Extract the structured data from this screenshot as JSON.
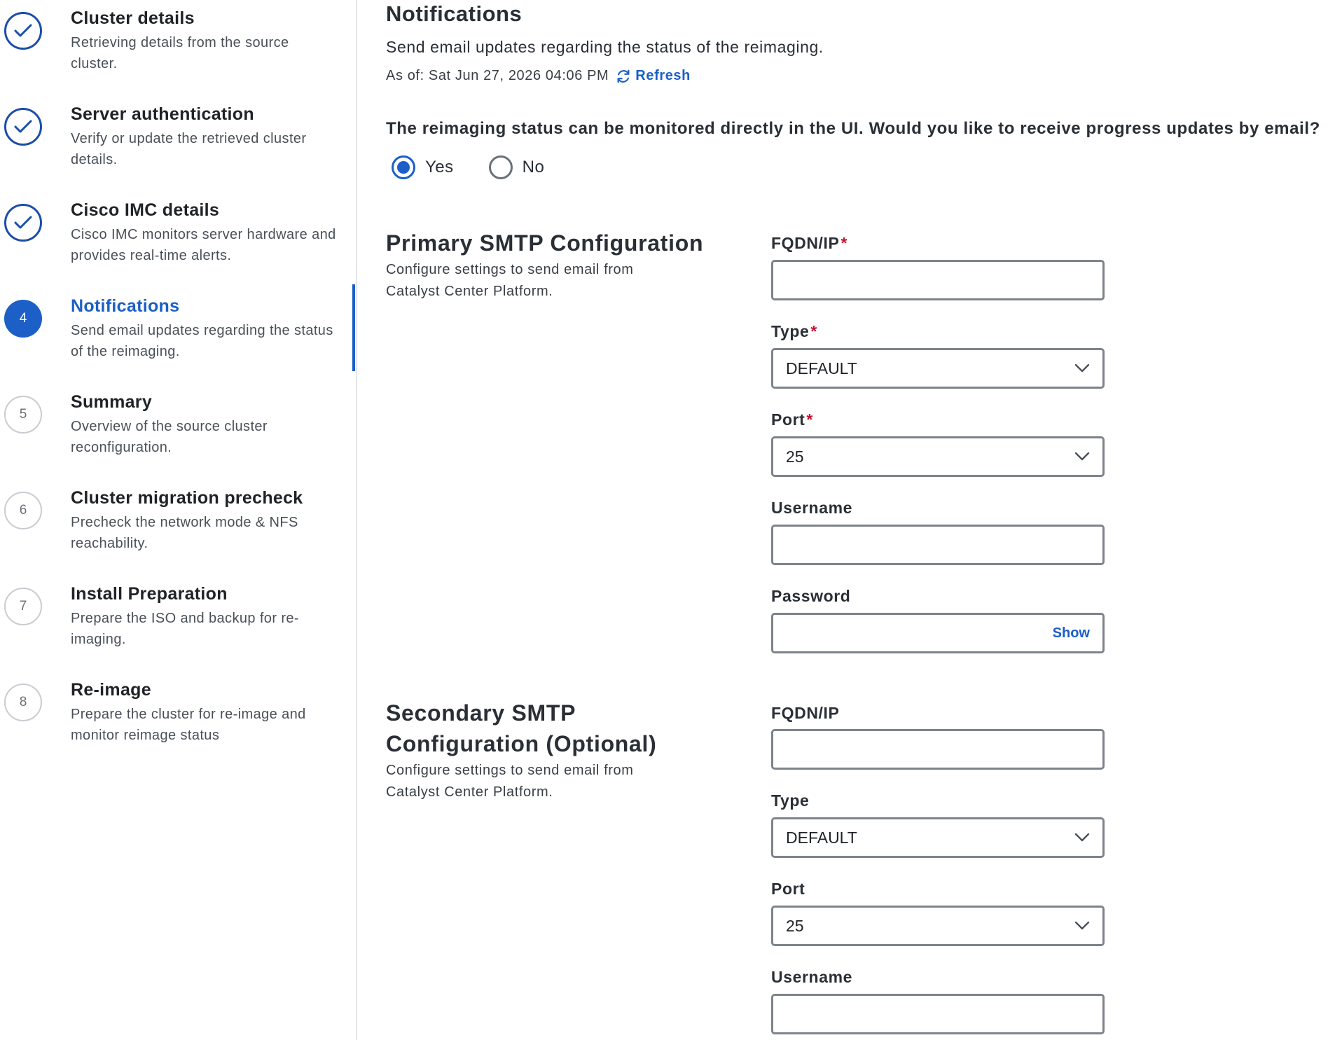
{
  "sidebar": {
    "steps": [
      {
        "number": "",
        "status": "done",
        "title": "Cluster details",
        "desc": "Retrieving details from the source cluster."
      },
      {
        "number": "",
        "status": "done",
        "title": "Server authentication",
        "desc": "Verify or update the retrieved cluster details."
      },
      {
        "number": "",
        "status": "done",
        "title": "Cisco IMC details",
        "desc": "Cisco IMC monitors server hardware and provides real-time alerts."
      },
      {
        "number": "4",
        "status": "current",
        "title": "Notifications",
        "desc": "Send email updates regarding the status of the reimaging."
      },
      {
        "number": "5",
        "status": "todo",
        "title": "Summary",
        "desc": "Overview of the source cluster reconfiguration."
      },
      {
        "number": "6",
        "status": "todo",
        "title": "Cluster migration precheck",
        "desc": "Precheck the network mode & NFS reachability."
      },
      {
        "number": "7",
        "status": "todo",
        "title": "Install Preparation",
        "desc": "Prepare the ISO and backup for re-imaging."
      },
      {
        "number": "8",
        "status": "todo",
        "title": "Re-image",
        "desc": "Prepare the cluster for re-image and monitor reimage status"
      }
    ]
  },
  "main": {
    "title": "Notifications",
    "subtitle": "Send email updates regarding the status of the reimaging.",
    "as_of": "As of: Sat Jun 27, 2026 04:06 PM",
    "refresh_label": "Refresh",
    "question": "The reimaging status can be monitored directly in the UI. Would you like to receive progress updates by email?",
    "radio_yes": "Yes",
    "radio_no": "No",
    "selected": "Yes"
  },
  "primary": {
    "title": "Primary SMTP Configuration",
    "desc": "Configure settings to send email from Catalyst Center Platform.",
    "fqdn_label": "FQDN/IP",
    "fqdn_value": "",
    "type_label": "Type",
    "type_value": "DEFAULT",
    "port_label": "Port",
    "port_value": "25",
    "username_label": "Username",
    "username_value": "",
    "password_label": "Password",
    "password_value": "",
    "show_label": "Show",
    "required_mark": "*"
  },
  "secondary": {
    "title_line1": "Secondary SMTP",
    "title_line2": "Configuration (Optional)",
    "desc": "Configure settings to send email from Catalyst Center Platform.",
    "fqdn_label": "FQDN/IP",
    "fqdn_value": "",
    "type_label": "Type",
    "type_value": "DEFAULT",
    "port_label": "Port",
    "port_value": "25",
    "username_label": "Username",
    "username_value": ""
  },
  "colors": {
    "accent": "#1b5fc7",
    "required": "#c8102e",
    "border": "#7d838a"
  }
}
